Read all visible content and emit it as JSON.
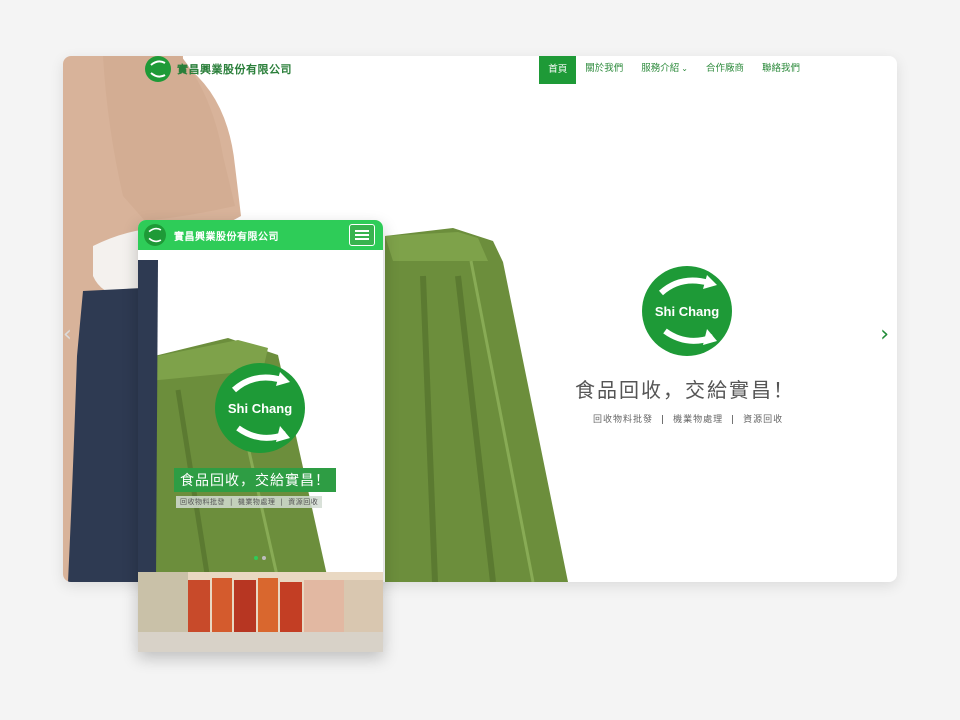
{
  "company": {
    "name": "實昌興業股份有限公司"
  },
  "logo": {
    "text": "Shi Chang",
    "color": "#1e9a37"
  },
  "desktop": {
    "menu": [
      {
        "label": "首頁",
        "active": true
      },
      {
        "label": "關於我們"
      },
      {
        "label": "服務介紹",
        "has_dropdown": true
      },
      {
        "label": "合作廠商"
      },
      {
        "label": "聯絡我們"
      }
    ],
    "hero": {
      "tagline": "食品回收，交給實昌！",
      "sub_items": [
        "回收物料批發",
        "機業物處理",
        "資源回收"
      ]
    },
    "slider": {
      "prev_icon": "chevron-left-icon",
      "next_icon": "chevron-right-icon"
    }
  },
  "mobile": {
    "hero": {
      "tagline": "食品回收，交給實昌！",
      "sub_items": [
        "回收物料批發",
        "機業物處理",
        "資源回收"
      ]
    },
    "slide_dots": {
      "count": 2,
      "active": 1
    }
  },
  "colors": {
    "brand_green": "#1e9a37",
    "bin_green": "#6f8f3c",
    "mobile_bar": "#2ecc58"
  }
}
